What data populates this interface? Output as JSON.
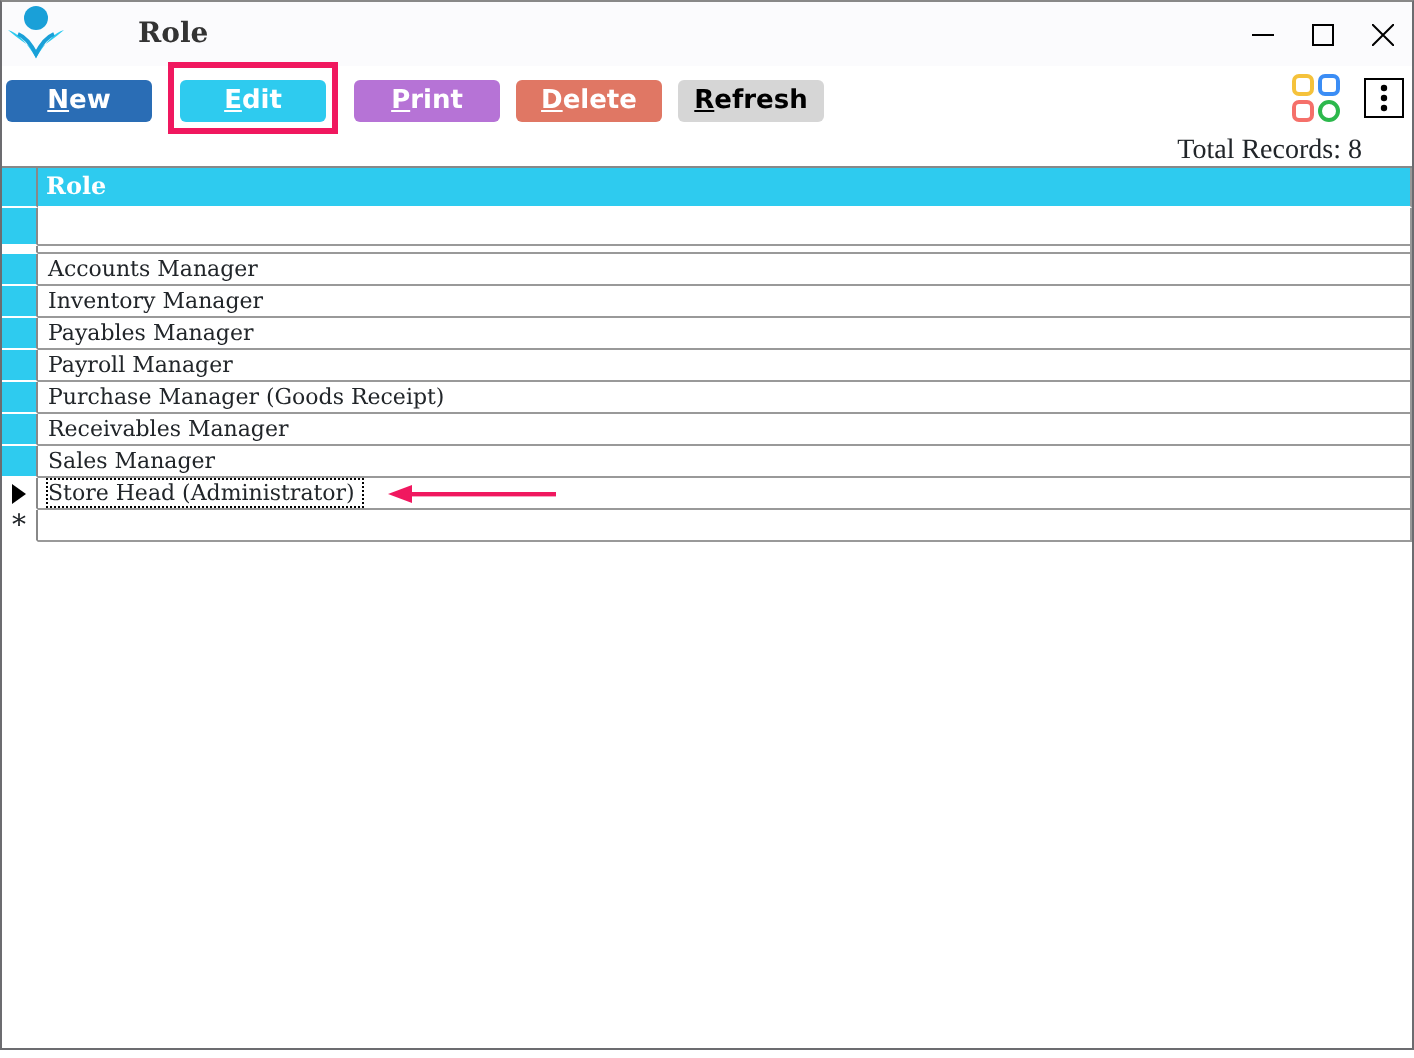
{
  "window": {
    "title": "Role"
  },
  "toolbar": [
    {
      "label": "New",
      "color": "#2a6db5",
      "highlighted": false
    },
    {
      "label": "Edit",
      "color": "#2ecbef",
      "highlighted": true
    },
    {
      "label": "Print",
      "color": "#b673d6",
      "highlighted": false
    },
    {
      "label": "Delete",
      "color": "#e07764",
      "highlighted": false
    },
    {
      "label": "Refresh",
      "color": "#d6d6d6",
      "highlighted": false
    }
  ],
  "total_records": "Total Records: 8",
  "table": {
    "columns": [
      "Role"
    ],
    "rows": [
      {
        "role": "Accounts Manager",
        "selected": false,
        "pointed": false
      },
      {
        "role": "Inventory Manager",
        "selected": false,
        "pointed": false
      },
      {
        "role": "Payables Manager",
        "selected": false,
        "pointed": false
      },
      {
        "role": "Payroll Manager",
        "selected": false,
        "pointed": false
      },
      {
        "role": "Purchase Manager (Goods Receipt)",
        "selected": false,
        "pointed": false
      },
      {
        "role": "Receivables Manager",
        "selected": false,
        "pointed": false
      },
      {
        "role": "Sales Manager",
        "selected": false,
        "pointed": false
      },
      {
        "role": "Store Head (Administrator)",
        "selected": true,
        "pointed": true
      }
    ],
    "new_row_marker": "*"
  }
}
